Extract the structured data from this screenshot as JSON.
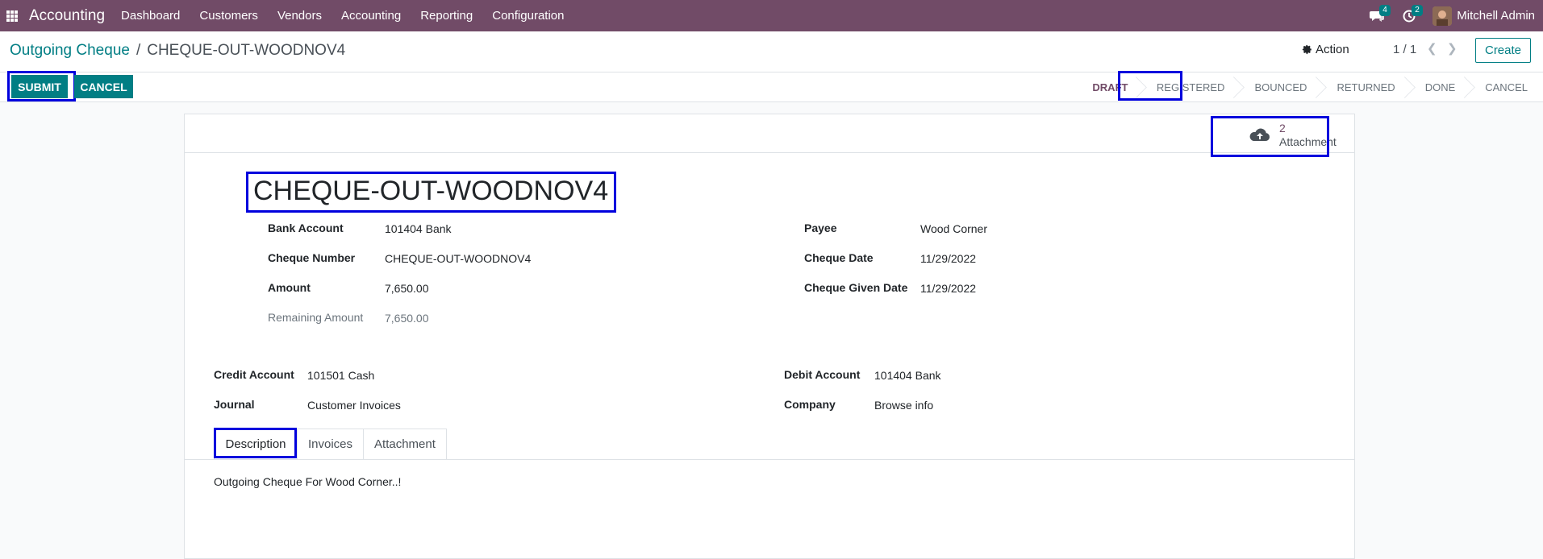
{
  "navbar": {
    "app_name": "Accounting",
    "menu": [
      "Dashboard",
      "Customers",
      "Vendors",
      "Accounting",
      "Reporting",
      "Configuration"
    ],
    "messages_count": "4",
    "activities_count": "2",
    "user_name": "Mitchell Admin"
  },
  "breadcrumb": {
    "parent": "Outgoing Cheque",
    "separator": "/",
    "current": "CHEQUE-OUT-WOODNOV4"
  },
  "control": {
    "action_label": "Action",
    "pager": "1 / 1",
    "create_label": "Create",
    "submit_label": "SUBMIT",
    "cancel_label": "CANCEL"
  },
  "stages": [
    "DRAFT",
    "REGISTERED",
    "BOUNCED",
    "RETURNED",
    "DONE",
    "CANCEL"
  ],
  "active_stage": "DRAFT",
  "attachment": {
    "count": "2",
    "label": "Attachment"
  },
  "form": {
    "title": "CHEQUE-OUT-WOODNOV4",
    "bank_account_label": "Bank Account",
    "bank_account": "101404 Bank",
    "cheque_number_label": "Cheque Number",
    "cheque_number": "CHEQUE-OUT-WOODNOV4",
    "amount_label": "Amount",
    "amount": "7,650.00",
    "remaining_label": "Remaining Amount",
    "remaining": "7,650.00",
    "payee_label": "Payee",
    "payee": "Wood Corner",
    "cheque_date_label": "Cheque Date",
    "cheque_date": "11/29/2022",
    "given_date_label": "Cheque Given Date",
    "given_date": "11/29/2022",
    "credit_account_label": "Credit Account",
    "credit_account": "101501 Cash",
    "journal_label": "Journal",
    "journal": "Customer Invoices",
    "debit_account_label": "Debit Account",
    "debit_account": "101404 Bank",
    "company_label": "Company",
    "company": "Browse info"
  },
  "tabs": [
    "Description",
    "Invoices",
    "Attachment"
  ],
  "description": "Outgoing Cheque For Wood Corner..!",
  "colors": {
    "brand": "#714b67",
    "accent": "#017e84",
    "highlight": "#0000dd"
  }
}
